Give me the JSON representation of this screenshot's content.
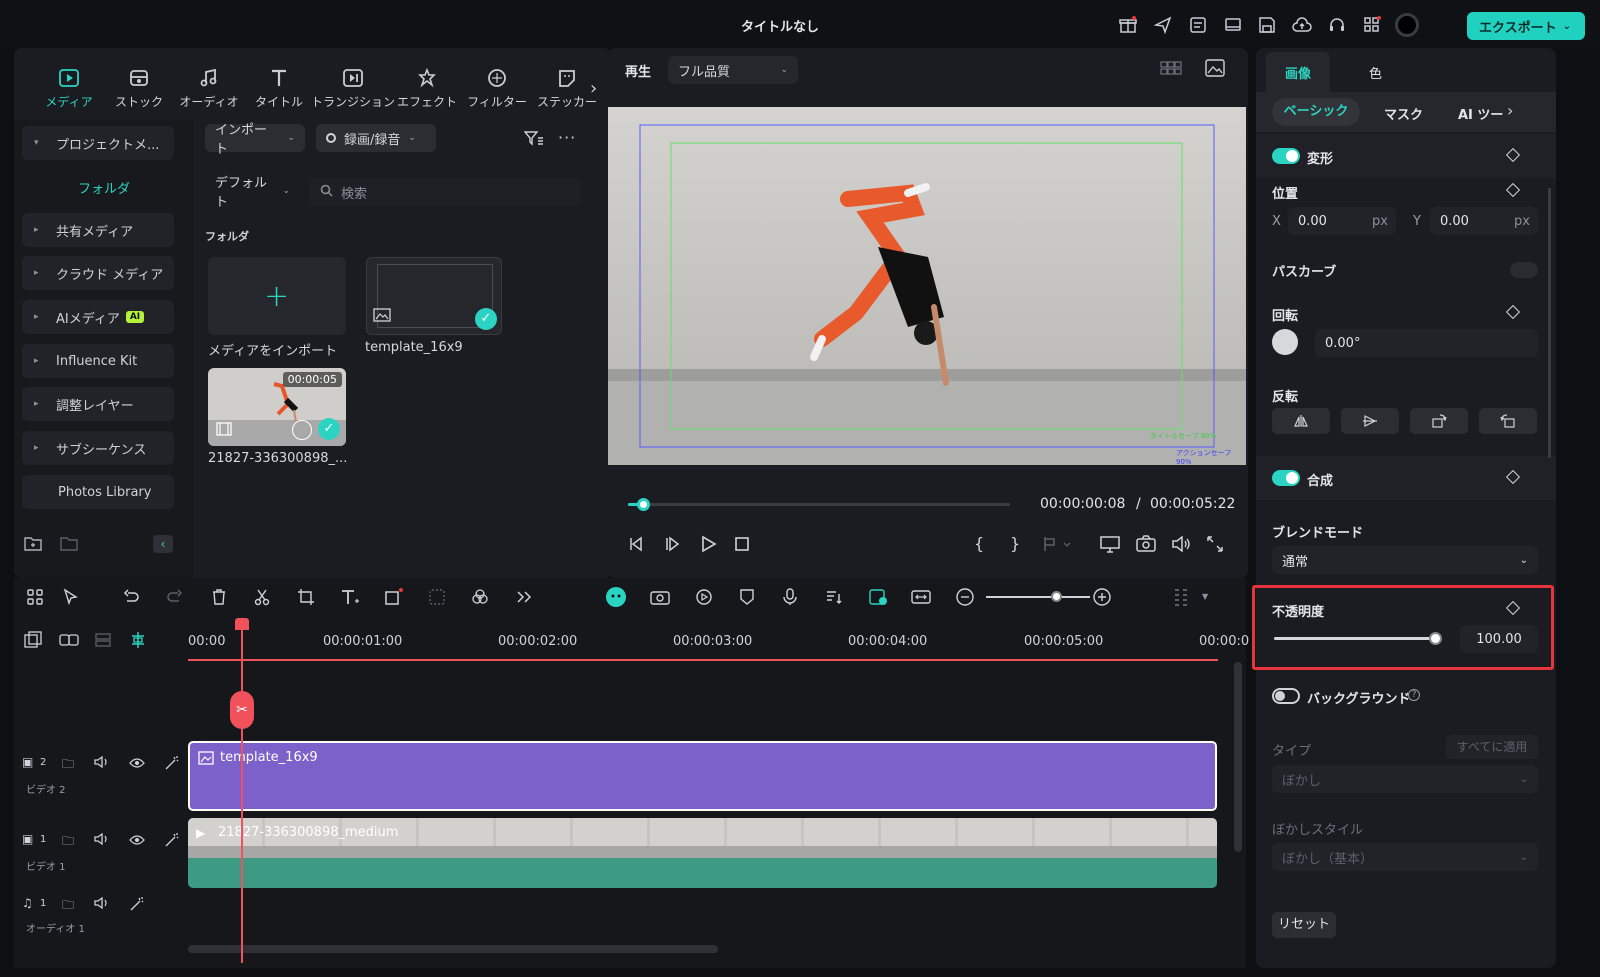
{
  "window": {
    "title": "タイトルなし"
  },
  "toolbar": {
    "export_label": "エクスポート"
  },
  "media_tabs": [
    {
      "label": "メディア",
      "icon": "media-icon",
      "active": true
    },
    {
      "label": "ストック",
      "icon": "stock-icon"
    },
    {
      "label": "オーディオ",
      "icon": "music-note-icon"
    },
    {
      "label": "タイトル",
      "icon": "title-t-icon"
    },
    {
      "label": "トランジション",
      "icon": "transition-icon"
    },
    {
      "label": "エフェクト",
      "icon": "effect-icon"
    },
    {
      "label": "フィルター",
      "icon": "filter-icon"
    },
    {
      "label": "ステッカー",
      "icon": "sticker-icon"
    }
  ],
  "sidebar": {
    "project_media": "プロジェクトメ...",
    "folder": "フォルダ",
    "items": [
      {
        "label": "共有メディア"
      },
      {
        "label": "クラウド メディア"
      },
      {
        "label": "AIメディア",
        "badge": "AI"
      },
      {
        "label": "Influence Kit"
      },
      {
        "label": "調整レイヤー"
      },
      {
        "label": "サブシーケンス"
      },
      {
        "label": "Photos Library"
      }
    ]
  },
  "media_panel": {
    "import_label": "インポート",
    "record_label": "録画/録音",
    "sort_label": "デフォルト",
    "search_placeholder": "検索",
    "folder_heading": "フォルダ",
    "items": [
      {
        "label": "メディアをインポート"
      },
      {
        "label": "template_16x9"
      },
      {
        "label": "21827-336300898_...",
        "duration": "00:00:05"
      }
    ]
  },
  "preview": {
    "play_label": "再生",
    "quality": "フル品質",
    "current_time": "00:00:00:08",
    "separator": "/",
    "total_time": "00:00:05:22",
    "progress": 0.04,
    "safe_title": "タイトルセーフ 80%",
    "safe_action": "アクションセーフ 90%"
  },
  "inspector": {
    "tabs": [
      "画像",
      "色"
    ],
    "subtabs": [
      "ベーシック",
      "マスク",
      "AI ツー"
    ],
    "transform": "変形",
    "position": "位置",
    "x_label": "X",
    "x_value": "0.00",
    "y_label": "Y",
    "y_value": "0.00",
    "unit": "px",
    "path_curve": "パスカーブ",
    "rotation": "回転",
    "rotation_value": "0.00°",
    "flip": "反転",
    "compositing": "合成",
    "blend_mode": "ブレンドモード",
    "blend_value": "通常",
    "opacity": "不透明度",
    "opacity_value": "100.00",
    "background": "バックグラウンド",
    "type": "タイプ",
    "apply_all": "すべてに適用",
    "blur": "ぼかし",
    "blur_style": "ぼかしスタイル",
    "blur_style_value": "ぼかし（基本）",
    "reset": "リセット"
  },
  "timeline": {
    "ruler": [
      "00:00",
      "00:00:01:00",
      "00:00:02:00",
      "00:00:03:00",
      "00:00:04:00",
      "00:00:05:00",
      "00:00:0"
    ],
    "tracks": [
      {
        "name": "ビデオ 2",
        "number": "2"
      },
      {
        "name": "ビデオ 1",
        "number": "1"
      },
      {
        "name": "オーディオ 1",
        "number": "1"
      }
    ],
    "clips": [
      {
        "label": "template_16x9"
      },
      {
        "label": "21827-336300898_medium"
      }
    ]
  },
  "colors": {
    "accent": "#2bd4c2",
    "clip_purple": "#7b61c9",
    "clip_green": "#3c9b82",
    "playhead": "#f0515b",
    "highlight": "#e8343c"
  }
}
